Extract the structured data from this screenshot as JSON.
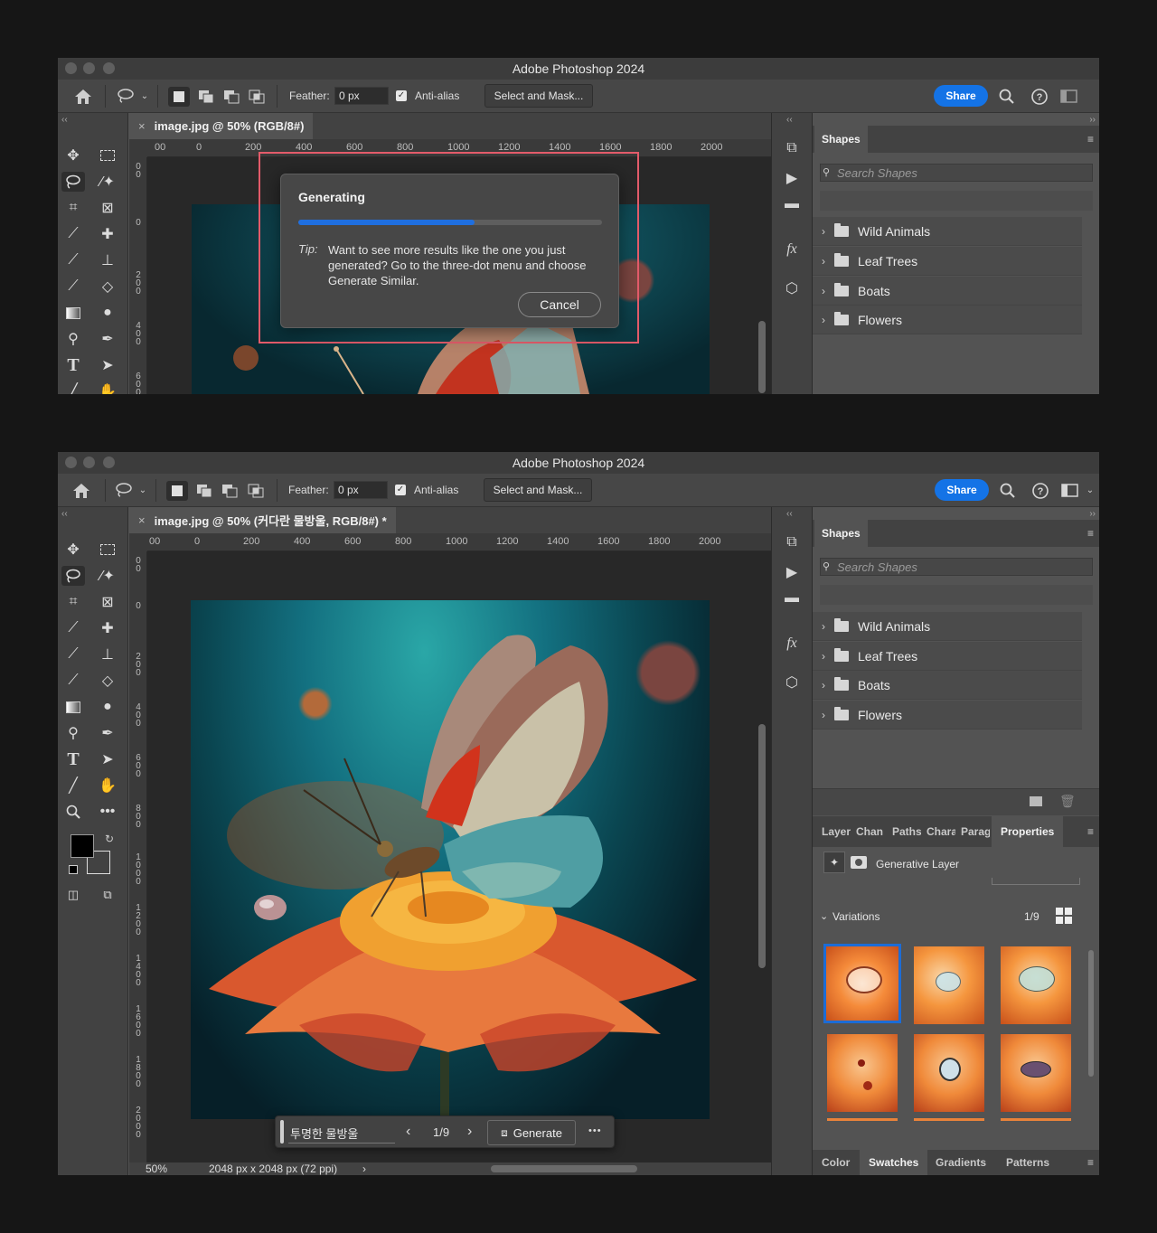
{
  "app_title": "Adobe Photoshop 2024",
  "options": {
    "feather_label": "Feather:",
    "feather_value": "0 px",
    "antialias_label": "Anti-alias",
    "antialias_check": "✓",
    "select_mask_label": "Select and Mask...",
    "share_label": "Share"
  },
  "window1": {
    "tab_title": "image.jpg @ 50% (RGB/8#)",
    "ruler_h": [
      "00",
      "0",
      "200",
      "400",
      "600",
      "800",
      "1000",
      "1200",
      "1400",
      "1600",
      "1800",
      "2000"
    ],
    "ruler_v": [
      "0\n0",
      "0",
      "2\n0\n0",
      "4\n0\n0",
      "6\n0\n0"
    ],
    "dialog": {
      "title": "Generating",
      "progress": 0.58,
      "tip_label": "Tip:",
      "tip_text": "Want to see more results like the one you just generated? Go to the three-dot menu and choose Generate Similar.",
      "cancel_label": "Cancel"
    }
  },
  "window2": {
    "tab_title": "image.jpg @ 50% (커다란 물방울, RGB/8#) *",
    "ruler_h": [
      "00",
      "0",
      "200",
      "400",
      "600",
      "800",
      "1000",
      "1200",
      "1400",
      "1600",
      "1800",
      "2000"
    ],
    "ruler_v": [
      "0\n0",
      "0",
      "2\n0\n0",
      "4\n0\n0",
      "6\n0\n0",
      "8\n0\n0",
      "1\n0\n0\n0",
      "1\n2\n0\n0",
      "1\n4\n0\n0",
      "1\n6\n0\n0",
      "1\n8\n0\n0",
      "2\n0\n0\n0"
    ],
    "zoom": "50%",
    "doc_size": "2048 px x 2048 px (72 ppi)",
    "contextual": {
      "prompt": "투명한 물방울",
      "counter": "1/9",
      "generate_label": "Generate",
      "more": "•••"
    },
    "bottom_tabs": [
      "Layer",
      "Chan",
      "Paths",
      "Chara",
      "Parag",
      "Properties"
    ],
    "generative_layer_label": "Generative Layer",
    "variations_label": "Variations",
    "variations_counter": "1/9",
    "footer_tabs": [
      "Color",
      "Swatches",
      "Gradients",
      "Patterns"
    ]
  },
  "shapes_panel": {
    "title": "Shapes",
    "search_placeholder": "Search Shapes",
    "folders": [
      "Wild Animals",
      "Leaf Trees",
      "Boats",
      "Flowers"
    ]
  },
  "icons": [
    "home-icon",
    "lasso-icon",
    "chevron-down-icon",
    "new-selection-icon",
    "add-selection-icon",
    "subtract-selection-icon",
    "intersect-selection-icon",
    "search-icon",
    "help-icon",
    "workspace-icon",
    "move-icon",
    "marquee-icon",
    "crop-icon",
    "frame-icon",
    "eyedropper-icon",
    "healing-icon",
    "brush-icon",
    "stamp-icon",
    "history-brush-icon",
    "eraser-icon",
    "gradient-icon",
    "blur-icon",
    "dodge-icon",
    "pen-icon",
    "type-icon",
    "path-select-icon",
    "line-icon",
    "hand-icon",
    "zoom-icon",
    "more-icon",
    "folder-icon",
    "trash-icon",
    "grid-icon"
  ],
  "colors": {
    "accent": "#1473e6",
    "highlight_box": "#e35b6a",
    "selected_thumb": "#1c6cd6"
  }
}
